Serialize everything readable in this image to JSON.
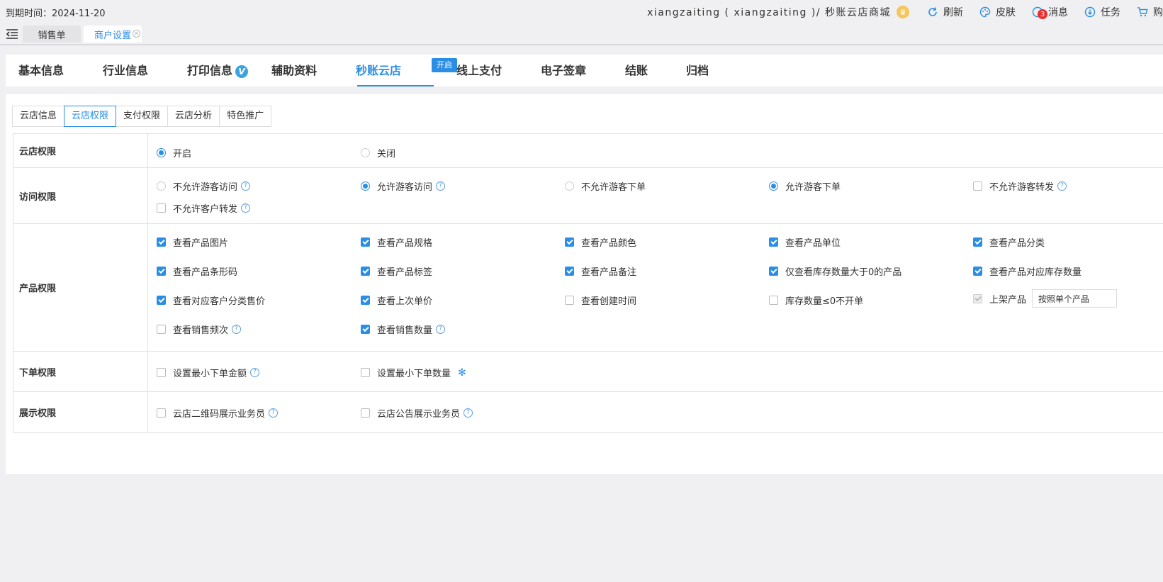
{
  "topbar": {
    "expire": "到期时间：2024-11-20",
    "user": "xiangzaiting ( xiangzaiting )/ 秒账云店商城",
    "refresh": "刷新",
    "skin": "皮肤",
    "messages": "消息",
    "message_count": "3",
    "tasks": "任务",
    "cart": "购"
  },
  "page_tabs": {
    "sales": "销售单",
    "merchant": "商户设置"
  },
  "main_nav": {
    "items": [
      "基本信息",
      "行业信息",
      "打印信息",
      "辅助资料",
      "秒账云店",
      "线上支付",
      "电子签章",
      "结账",
      "归档"
    ],
    "open_badge": "开启",
    "verified_mark": "V"
  },
  "sub_tabs": [
    "云店信息",
    "云店权限",
    "支付权限",
    "云店分析",
    "特色推广"
  ],
  "sections": {
    "store": {
      "label": "云店权限",
      "open": "开启",
      "close": "关闭"
    },
    "access": {
      "label": "访问权限",
      "opts": [
        "不允许游客访问",
        "允许游客访问",
        "不允许游客下单",
        "允许游客下单",
        "不允许游客转发",
        "不允许客户转发"
      ]
    },
    "product": {
      "label": "产品权限",
      "opts": [
        "查看产品图片",
        "查看产品规格",
        "查看产品颜色",
        "查看产品单位",
        "查看产品分类",
        "查看产品条形码",
        "查看产品标签",
        "查看产品备注",
        "仅查看库存数量大于0的产品",
        "查看产品对应库存数量",
        "查看对应客户分类售价",
        "查看上次单价",
        "查看创建时间",
        "库存数量≤0不开单",
        "上架产品",
        "查看销售频次",
        "查看销售数量"
      ],
      "shelf_select": "按照单个产品"
    },
    "order": {
      "label": "下单权限",
      "opts": [
        "设置最小下单金额",
        "设置最小下单数量"
      ]
    },
    "display": {
      "label": "展示权限",
      "opts": [
        "云店二维码展示业务员",
        "云店公告展示业务员"
      ]
    }
  }
}
